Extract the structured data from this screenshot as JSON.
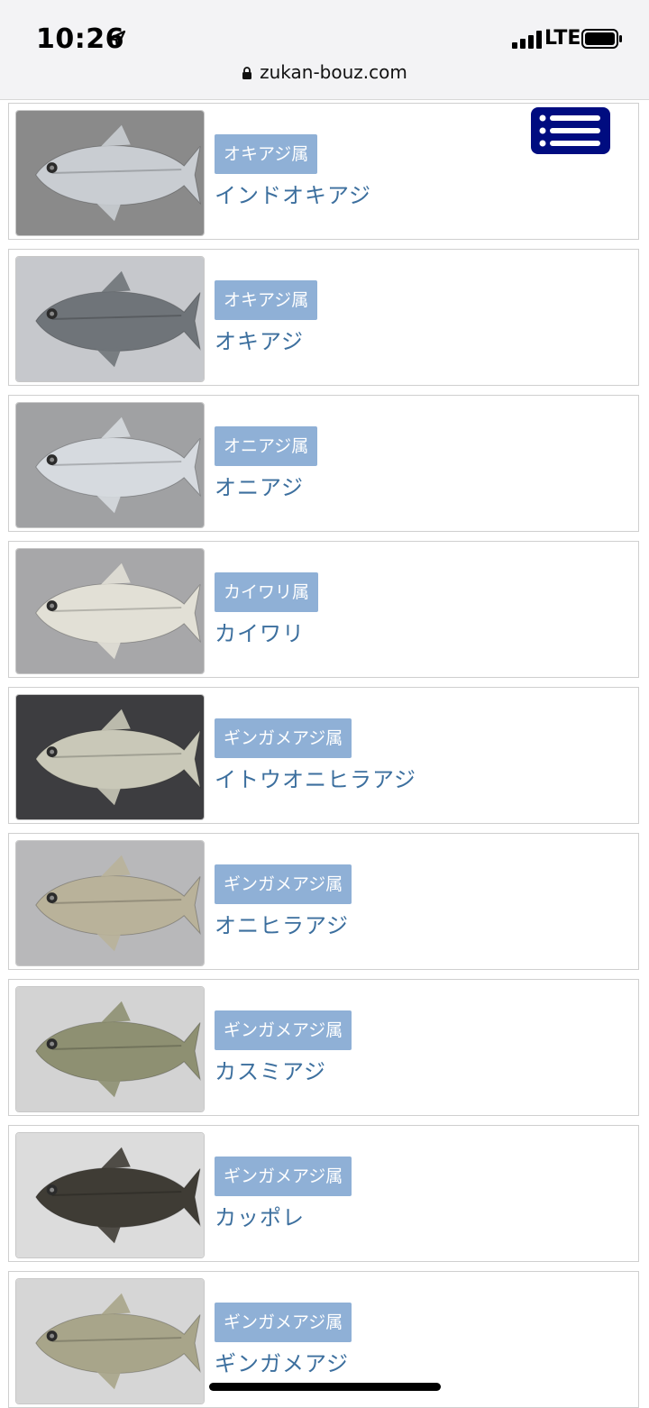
{
  "status": {
    "time": "10:26",
    "network": "LTE",
    "location_icon": "location-arrow-icon"
  },
  "browser": {
    "url": "zukan-bouz.com",
    "lock_icon": "lock-icon"
  },
  "menu": {
    "icon": "list-menu-icon"
  },
  "items": [
    {
      "genus": "オキアジ属",
      "name": "インドオキアジ",
      "bg": "#8a8a8a",
      "fish": "#c9cdd2"
    },
    {
      "genus": "オキアジ属",
      "name": "オキアジ",
      "bg": "#c6c8cc",
      "fish": "#6f7479"
    },
    {
      "genus": "オニアジ属",
      "name": "オニアジ",
      "bg": "#a0a1a3",
      "fish": "#d6dadf"
    },
    {
      "genus": "カイワリ属",
      "name": "カイワリ",
      "bg": "#a7a7a9",
      "fish": "#e2e0d6"
    },
    {
      "genus": "ギンガメアジ属",
      "name": "イトウオニヒラアジ",
      "bg": "#3d3d40",
      "fish": "#c9c8b8"
    },
    {
      "genus": "ギンガメアジ属",
      "name": "オニヒラアジ",
      "bg": "#b8b8ba",
      "fish": "#b9b29a"
    },
    {
      "genus": "ギンガメアジ属",
      "name": "カスミアジ",
      "bg": "#d3d3d3",
      "fish": "#8e9072"
    },
    {
      "genus": "ギンガメアジ属",
      "name": "カッポレ",
      "bg": "#dcdcdc",
      "fish": "#3f3c35"
    },
    {
      "genus": "ギンガメアジ属",
      "name": "ギンガメアジ",
      "bg": "#d6d6d6",
      "fish": "#a8a58a"
    }
  ]
}
